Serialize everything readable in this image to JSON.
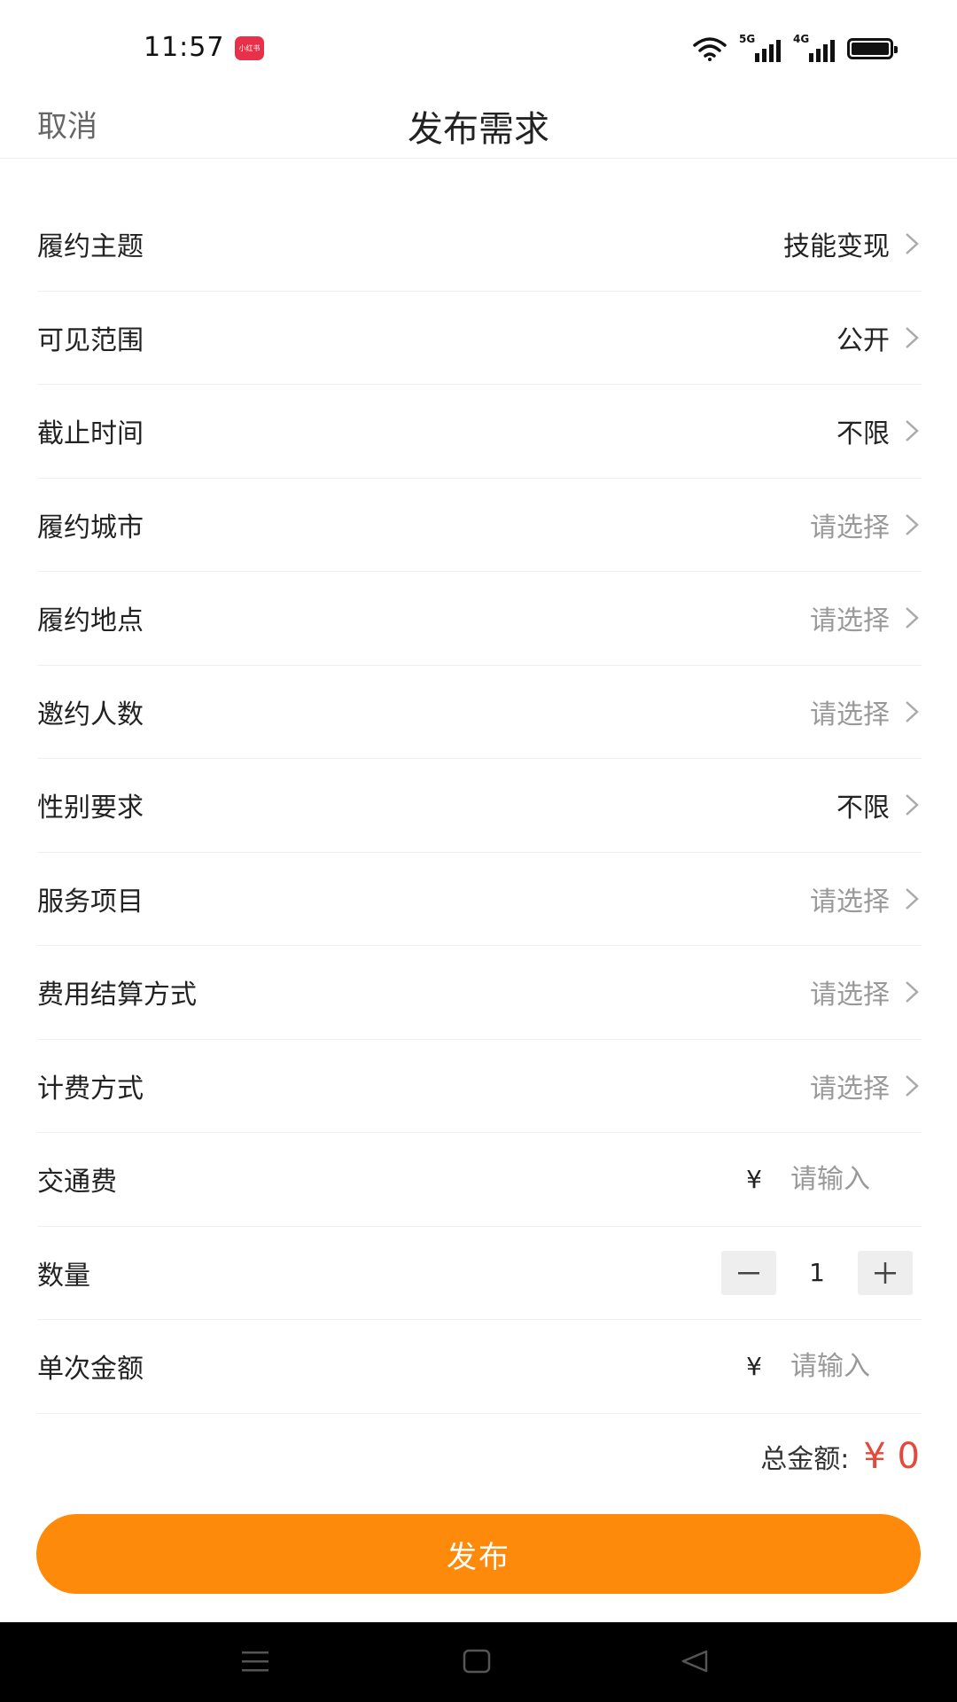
{
  "status_bar": {
    "time": "11:57",
    "app_badge": "小红书",
    "network_1": "5G",
    "network_2": "4G"
  },
  "nav": {
    "cancel": "取消",
    "title": "发布需求"
  },
  "form": {
    "rows": [
      {
        "label": "履约主题",
        "value": "技能变现"
      },
      {
        "label": "可见范围",
        "value": "公开"
      },
      {
        "label": "截止时间",
        "value": "不限"
      },
      {
        "label": "履约城市",
        "value": "请选择"
      },
      {
        "label": "履约地点",
        "value": "请选择"
      },
      {
        "label": "邀约人数",
        "value": "请选择"
      },
      {
        "label": "性别要求",
        "value": "不限"
      },
      {
        "label": "服务项目",
        "value": "请选择"
      },
      {
        "label": "费用结算方式",
        "value": "请选择"
      },
      {
        "label": "计费方式",
        "value": "请选择"
      }
    ],
    "transport_fee": {
      "label": "交通费",
      "currency": "¥",
      "placeholder": "请输入"
    },
    "quantity": {
      "label": "数量",
      "value": "1"
    },
    "unit_amount": {
      "label": "单次金额",
      "currency": "¥",
      "placeholder": "请输入"
    }
  },
  "total": {
    "label": "总金额:",
    "value": "¥ 0"
  },
  "submit_label": "发布",
  "colors": {
    "accent": "#fd8a0a",
    "total_red": "#e5493a",
    "placeholder": "#999999"
  }
}
